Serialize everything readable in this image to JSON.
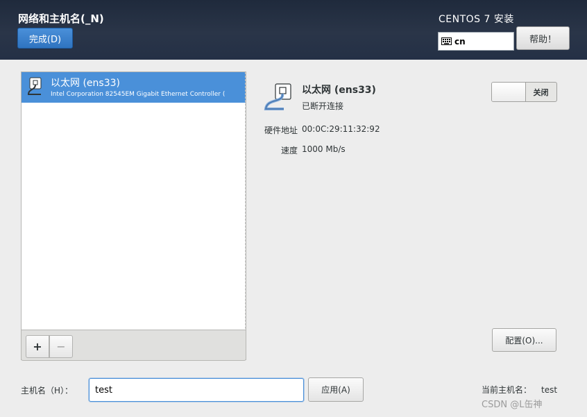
{
  "header": {
    "screen_title": "网络和主机名(_N)",
    "done_label": "完成(D)",
    "install_title": "CENTOS 7 安装",
    "keyboard_layout": "cn",
    "help_label": "帮助！"
  },
  "device_list": {
    "items": [
      {
        "name": "以太网 (ens33)",
        "description": "Intel Corporation 82545EM Gigabit Ethernet Controller (",
        "selected": true
      }
    ],
    "add_label": "+",
    "remove_label": "−"
  },
  "device_detail": {
    "name": "以太网 (ens33)",
    "status": "已断开连接",
    "hw_addr_label": "硬件地址",
    "hw_addr_value": "00:0C:29:11:32:92",
    "speed_label": "速度",
    "speed_value": "1000 Mb/s",
    "switch_label": "关闭",
    "switch_on": false,
    "configure_label": "配置(O)..."
  },
  "hostname": {
    "label": "主机名（H）：",
    "value": "test",
    "apply_label": "应用(A)",
    "current_label": "当前主机名：",
    "current_value": "test"
  },
  "watermark": "CSDN @L缶神",
  "colors": {
    "accent": "#4a90d9",
    "header_bg": "#243046",
    "content_bg": "#ededed"
  }
}
